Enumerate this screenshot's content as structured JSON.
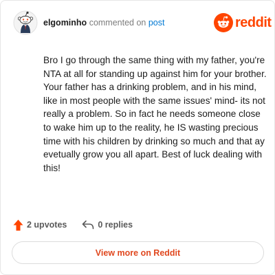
{
  "header": {
    "username": "elgominho",
    "action_text": "commented on",
    "post_link": "post",
    "brand_word": "reddit"
  },
  "comment": {
    "body": "Bro I go through the same thing with my father, you're NTA at all for standing up against him for your brother. Your father has a drinking problem, and in his mind, like in most people with the same issues' mind- its not really a problem. So in fact he needs someone close to wake him up to the reality, he IS wasting precious time with his children by drinking so much and that ay evetually grow you all apart. Best of luck dealing with this!"
  },
  "actions": {
    "upvotes": "2 upvotes",
    "replies": "0 replies"
  },
  "footer": {
    "view_more": "View more on Reddit"
  },
  "colors": {
    "brand": "#ff4500",
    "link": "#0079d3",
    "view_more_text": "#e0481f"
  },
  "icons": {
    "avatar": "snoo-avatar",
    "brand": "reddit-logo-icon",
    "upvote": "upvote-arrow-icon",
    "reply": "reply-arrow-icon"
  }
}
